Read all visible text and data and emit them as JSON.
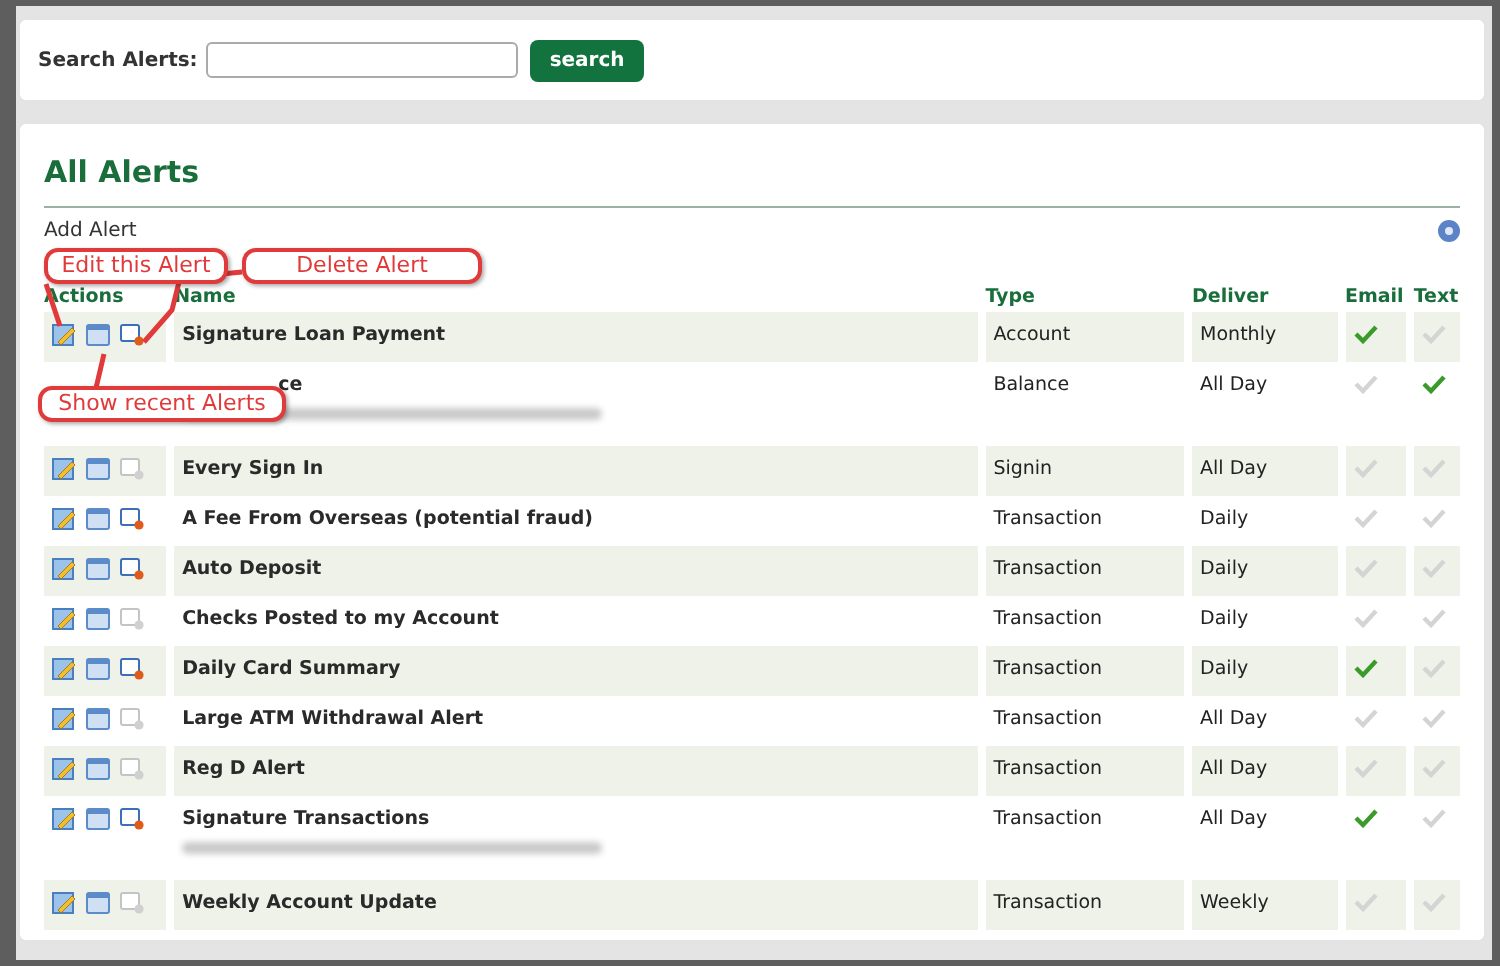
{
  "search": {
    "label": "Search Alerts:",
    "button": "search"
  },
  "panel": {
    "title": "All Alerts",
    "add_link": "Add Alert"
  },
  "columns": [
    "Actions",
    "Name",
    "Type",
    "Deliver",
    "Email",
    "Text"
  ],
  "rows": [
    {
      "name": "Signature Loan Payment",
      "type": "Account",
      "deliver": "Monthly",
      "email": true,
      "text_on": false,
      "delete_enabled": true,
      "has_detail": false
    },
    {
      "name": "ce",
      "type": "Balance",
      "deliver": "All Day",
      "email": false,
      "text_on": true,
      "covered": true,
      "has_detail": true
    },
    {
      "name": "Every Sign In",
      "type": "Signin",
      "deliver": "All Day",
      "email": false,
      "text_on": false,
      "delete_enabled": false,
      "has_detail": false
    },
    {
      "name": "A Fee From Overseas (potential fraud)",
      "type": "Transaction",
      "deliver": "Daily",
      "email": false,
      "text_on": false,
      "delete_enabled": true,
      "has_detail": false
    },
    {
      "name": "Auto Deposit",
      "type": "Transaction",
      "deliver": "Daily",
      "email": false,
      "text_on": false,
      "delete_enabled": true,
      "has_detail": false
    },
    {
      "name": "Checks Posted to my Account",
      "type": "Transaction",
      "deliver": "Daily",
      "email": false,
      "text_on": false,
      "delete_enabled": false,
      "has_detail": false
    },
    {
      "name": "Daily Card Summary",
      "type": "Transaction",
      "deliver": "Daily",
      "email": true,
      "text_on": false,
      "delete_enabled": true,
      "has_detail": false
    },
    {
      "name": "Large ATM Withdrawal Alert",
      "type": "Transaction",
      "deliver": "All Day",
      "email": false,
      "text_on": false,
      "delete_enabled": false,
      "has_detail": false
    },
    {
      "name": "Reg D Alert",
      "type": "Transaction",
      "deliver": "All Day",
      "email": false,
      "text_on": false,
      "delete_enabled": false,
      "has_detail": false
    },
    {
      "name": "Signature Transactions",
      "type": "Transaction",
      "deliver": "All Day",
      "email": true,
      "text_on": false,
      "delete_enabled": true,
      "has_detail": true
    },
    {
      "name": "Weekly Account Update",
      "type": "Transaction",
      "deliver": "Weekly",
      "email": false,
      "text_on": false,
      "delete_enabled": false,
      "has_detail": false
    }
  ],
  "callouts": [
    {
      "text": "Edit this Alert",
      "kind": "edit"
    },
    {
      "text": "Delete Alert",
      "kind": "delete"
    },
    {
      "text": "Show recent Alerts",
      "kind": "recent"
    }
  ]
}
